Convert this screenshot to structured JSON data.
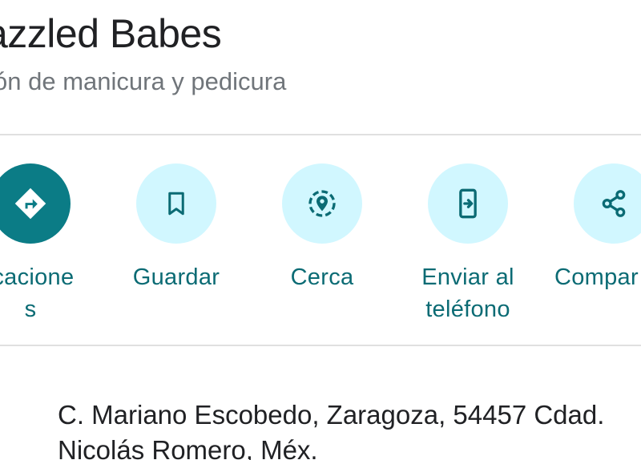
{
  "place": {
    "name": "azzled Babes",
    "category": "ón de manicura y pedicura"
  },
  "actions": [
    {
      "label": "icacione\ns",
      "icon": "directions-icon"
    },
    {
      "label": "Guardar",
      "icon": "bookmark-icon"
    },
    {
      "label": "Cerca",
      "icon": "nearby-icon"
    },
    {
      "label": "Enviar al\nteléfono",
      "icon": "send-to-phone-icon"
    },
    {
      "label": "Compar",
      "icon": "share-icon"
    }
  ],
  "address": {
    "line1": "C. Mariano Escobedo, Zaragoza, 54457 Cdad.",
    "line2": "Nicolás Romero, Méx.",
    "icon": "location-pin-icon"
  },
  "colors": {
    "accent": "#0b7c86",
    "action_bg": "#d1f7ff",
    "action_text": "#0b6b74",
    "subtitle": "#70757a"
  }
}
